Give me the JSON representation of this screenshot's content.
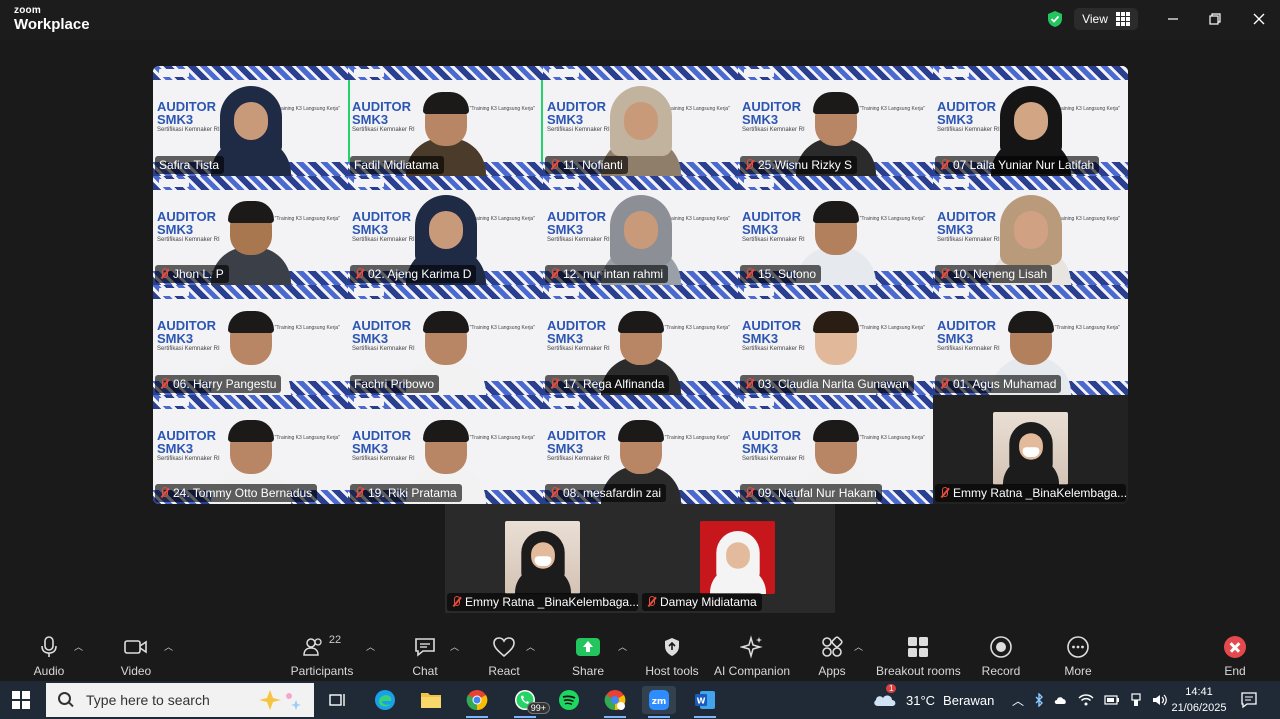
{
  "window": {
    "brand_line1": "zoom",
    "brand_line2": "Workplace",
    "view_label": "View"
  },
  "tile_brand": {
    "line1": "AUDITOR",
    "line2": "SMK3",
    "line3": "Sertifikasi Kemnaker RI",
    "quote": "\"Training K3 Langsung Kerja\""
  },
  "participants": [
    {
      "name": "Safira Tista",
      "muted": false,
      "active": false,
      "style": "hijab-dark"
    },
    {
      "name": "Fadil Midiatama",
      "muted": false,
      "active": true,
      "style": "man-batik"
    },
    {
      "name": "11. Nofianti",
      "muted": true,
      "active": false,
      "style": "hijab-light"
    },
    {
      "name": "25.Wisnu Rizky S",
      "muted": true,
      "active": false,
      "style": "man-dark"
    },
    {
      "name": "07 Laila Yuniar Nur Latifah",
      "muted": true,
      "active": false,
      "style": "hijab-black"
    },
    {
      "name": "Jhon L. P",
      "muted": true,
      "active": false,
      "style": "man-headset"
    },
    {
      "name": "02. Ajeng Karima D",
      "muted": true,
      "active": false,
      "style": "hijab-dark"
    },
    {
      "name": "12. nur intan rahmi",
      "muted": true,
      "active": false,
      "style": "hijab-grey"
    },
    {
      "name": "15. Sutono",
      "muted": true,
      "active": false,
      "style": "man-glasses"
    },
    {
      "name": "10. Neneng Lisah",
      "muted": true,
      "active": false,
      "style": "hijab-beige"
    },
    {
      "name": "06. Harry Pangestu",
      "muted": true,
      "active": false,
      "style": "man-white"
    },
    {
      "name": "Fachri Pribowo",
      "muted": false,
      "active": false,
      "style": "man-white"
    },
    {
      "name": "17. Rega Alfinanda",
      "muted": true,
      "active": false,
      "style": "man-dark"
    },
    {
      "name": "03. Claudia Narita Gunawan",
      "muted": true,
      "active": false,
      "style": "woman-hair"
    },
    {
      "name": "01. Agus Muhamad",
      "muted": true,
      "active": false,
      "style": "man-glasses"
    },
    {
      "name": "24. Tommy Otto Bernadus",
      "muted": true,
      "active": false,
      "style": "man-white"
    },
    {
      "name": "19. Riki Pratama",
      "muted": true,
      "active": false,
      "style": "man-white"
    },
    {
      "name": "08. mesafardin zai",
      "muted": true,
      "active": false,
      "style": "man-dark"
    },
    {
      "name": "09. Naufal Nur Hakam",
      "muted": true,
      "active": false,
      "style": "man-white"
    },
    {
      "name": "Emmy Ratna _BinaKelembaga...",
      "muted": true,
      "active": false,
      "style": "avatar-mask"
    }
  ],
  "second_row": [
    {
      "name": "Emmy Ratna _BinaKelembaga...",
      "muted": true,
      "style": "avatar-mask"
    },
    {
      "name": "Damay Midiatama",
      "muted": true,
      "style": "avatar-red"
    }
  ],
  "toolbar": {
    "audio": "Audio",
    "video": "Video",
    "participants": "Participants",
    "participants_count": "22",
    "chat": "Chat",
    "react": "React",
    "share": "Share",
    "host_tools": "Host tools",
    "ai_companion": "AI Companion",
    "apps": "Apps",
    "breakout": "Breakout rooms",
    "record": "Record",
    "more": "More",
    "end": "End"
  },
  "taskbar": {
    "search_placeholder": "Type here to search",
    "whatsapp_badge": "99+",
    "weather_temp": "31°C",
    "weather_text": "Berawan",
    "weather_badge": "1",
    "time": "14:41",
    "date": "21/06/2025"
  },
  "colors": {
    "accent_green": "#22d36b",
    "muted_red": "#e74c3c",
    "end_red": "#e5484d",
    "share_green": "#22c55e"
  }
}
